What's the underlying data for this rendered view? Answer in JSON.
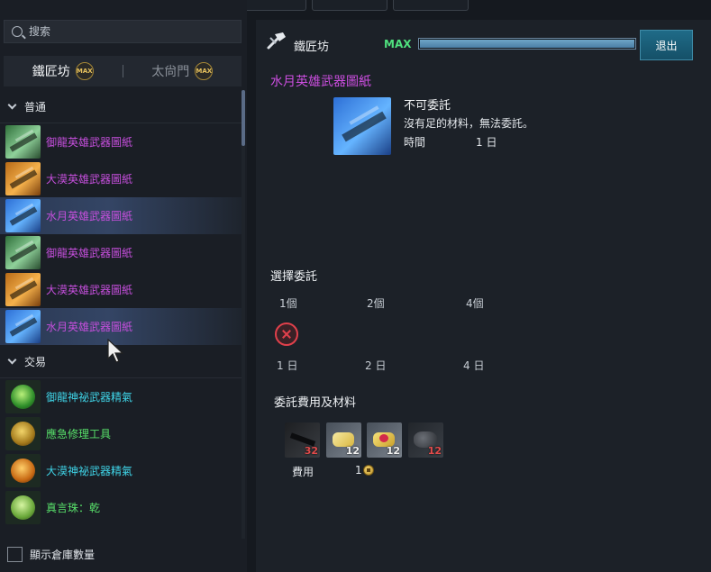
{
  "search": {
    "placeholder": "搜索"
  },
  "left_tabs": [
    {
      "label": "鐵匠坊",
      "badge": "MAX",
      "active": true
    },
    {
      "label": "太尙門",
      "badge": "MAX",
      "active": false
    }
  ],
  "categories": [
    {
      "label": "普通",
      "items": [
        {
          "name": "御龍英雄武器圖紙",
          "color": "#c54fdc",
          "icon": "green-scroll-icon",
          "selected": false
        },
        {
          "name": "大漠英雄武器圖紙",
          "color": "#c54fdc",
          "icon": "orange-scroll-icon",
          "selected": false
        },
        {
          "name": "水月英雄武器圖紙",
          "color": "#c54fdc",
          "icon": "blue-scroll-icon",
          "selected": true
        },
        {
          "name": "御龍英雄武器圖紙",
          "color": "#c54fdc",
          "icon": "green-scroll-icon",
          "selected": false
        },
        {
          "name": "大漠英雄武器圖紙",
          "color": "#c54fdc",
          "icon": "orange-scroll-icon",
          "selected": false
        },
        {
          "name": "水月英雄武器圖紙",
          "color": "#c54fdc",
          "icon": "blue-scroll-icon",
          "selected": true
        }
      ]
    },
    {
      "label": "交易",
      "items": [
        {
          "name": "御龍神祕武器精氣",
          "color": "#3fd3e6",
          "icon": "green-orb-icon",
          "selected": false
        },
        {
          "name": "應急修理工具",
          "color": "#58e06a",
          "icon": "hammer-tool-icon",
          "selected": false
        },
        {
          "name": "大漠神祕武器精氣",
          "color": "#3fd3e6",
          "icon": "orange-orb-icon",
          "selected": false
        },
        {
          "name": "真言珠：乾",
          "color": "#58e06a",
          "icon": "green-bead-icon",
          "selected": false
        }
      ]
    }
  ],
  "show_stock_label": "顯示倉庫數量",
  "header": {
    "title": "鐵匠坊",
    "max_label": "MAX",
    "progress": 1.0,
    "exit_label": "退出"
  },
  "detail": {
    "item_name": "水月英雄武器圖紙",
    "status_title": "不可委託",
    "status_desc": "沒有足的材料，無法委託。",
    "time_label": "時間",
    "time_value": "1 日"
  },
  "choose": {
    "title": "選擇委託",
    "options": [
      {
        "qty": "1個",
        "days": "1 日"
      },
      {
        "qty": "2個",
        "days": "2 日"
      },
      {
        "qty": "4個",
        "days": "4 日"
      }
    ]
  },
  "cost": {
    "title": "委託費用及材料",
    "materials": [
      {
        "icon": "dark-ingot-icon",
        "qty": "32"
      },
      {
        "icon": "gold-pouch-icon",
        "qty": "12"
      },
      {
        "icon": "red-gem-pouch-icon",
        "qty": "12"
      },
      {
        "icon": "stone-pile-icon",
        "qty": "12"
      }
    ],
    "fee_label": "費用",
    "fee_value": "1"
  },
  "colors": {
    "purple_text": "#cc4ee0",
    "max_green": "#4fe07e",
    "exit_button": "#1f6b88",
    "insufficient_red": "#e24b4b"
  }
}
